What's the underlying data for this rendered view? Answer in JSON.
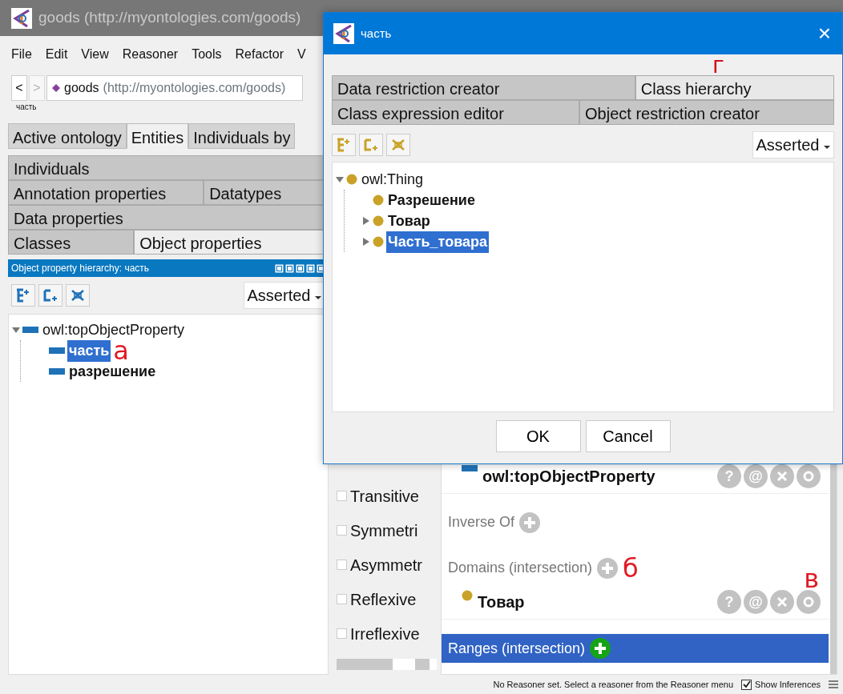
{
  "window": {
    "title": "goods (http://myontologies.com/goods)"
  },
  "menu": [
    "File",
    "Edit",
    "View",
    "Reasoner",
    "Tools",
    "Refactor",
    "V"
  ],
  "navigation": {
    "back": "<",
    "forward": ">",
    "ontology_name": "goods",
    "ontology_iri": "(http://myontologies.com/goods)",
    "breadcrumb": "часть"
  },
  "tabs": [
    {
      "label": "Active ontology",
      "selected": false
    },
    {
      "label": "Entities",
      "selected": true
    },
    {
      "label": "Individuals by",
      "selected": false
    }
  ],
  "entity_tabs": [
    [
      {
        "label": "Individuals",
        "selected": false
      }
    ],
    [
      {
        "label": "Annotation properties",
        "selected": false
      },
      {
        "label": "Datatypes",
        "selected": false
      }
    ],
    [
      {
        "label": "Data properties",
        "selected": false
      }
    ],
    [
      {
        "label": "Classes",
        "selected": false
      },
      {
        "label": "Object properties",
        "selected": true
      }
    ]
  ],
  "hierarchy_panel": {
    "title": "Object property hierarchy: часть",
    "mode": "Asserted",
    "tree": [
      {
        "label": "owl:topObjectProperty",
        "kind": "property",
        "expanded": true,
        "bold": false,
        "selected": false,
        "children": [
          {
            "label": "часть",
            "kind": "property",
            "bold": true,
            "selected": true,
            "annotation": "а"
          },
          {
            "label": "разрешение",
            "kind": "property",
            "bold": true,
            "selected": false
          }
        ]
      }
    ]
  },
  "characteristics": [
    {
      "label": "Transitive",
      "checked": false
    },
    {
      "label": "Symmetri",
      "checked": false
    },
    {
      "label": "Asymmetr",
      "checked": false
    },
    {
      "label": "Reflexive",
      "checked": false
    },
    {
      "label": "Irreflexive",
      "checked": false
    }
  ],
  "description": {
    "sub_property_items": [
      {
        "label": "owl:topObjectProperty",
        "kind": "property",
        "actions": [
          "?",
          "@"
        ]
      }
    ],
    "sections": [
      {
        "title": "Inverse Of",
        "highlighted": false
      },
      {
        "title": "Domains (intersection)",
        "highlighted": false,
        "annotation": "б",
        "items": [
          {
            "label": "Товар",
            "kind": "class",
            "actions": [
              "?",
              "@"
            ],
            "annotation": "в"
          }
        ]
      },
      {
        "title": "Ranges (intersection)",
        "highlighted": true
      }
    ]
  },
  "status_bar": {
    "message": "No Reasoner set. Select a reasoner from the Reasoner menu",
    "show_inferences": {
      "label": "Show Inferences",
      "checked": true
    }
  },
  "dialog": {
    "title": "часть",
    "close": "×",
    "tab_rows": [
      [
        {
          "label": "Data restriction creator",
          "selected": false
        },
        {
          "label": "Class hierarchy",
          "selected": true,
          "annotation": "г"
        }
      ],
      [
        {
          "label": "Class expression editor",
          "selected": false
        },
        {
          "label": "Object restriction creator",
          "selected": false
        }
      ]
    ],
    "mode": "Asserted",
    "tree": [
      {
        "label": "owl:Thing",
        "kind": "class",
        "expanded": true,
        "bold": false,
        "selected": false,
        "children": [
          {
            "label": "Разрешение",
            "kind": "class",
            "bold": true,
            "selected": false
          },
          {
            "label": "Товар",
            "kind": "class",
            "expanded": false,
            "bold": true,
            "selected": false
          },
          {
            "label": "Часть_товара",
            "kind": "class",
            "expanded": false,
            "bold": true,
            "selected": true
          }
        ]
      }
    ],
    "buttons": [
      "OK",
      "Cancel"
    ]
  }
}
